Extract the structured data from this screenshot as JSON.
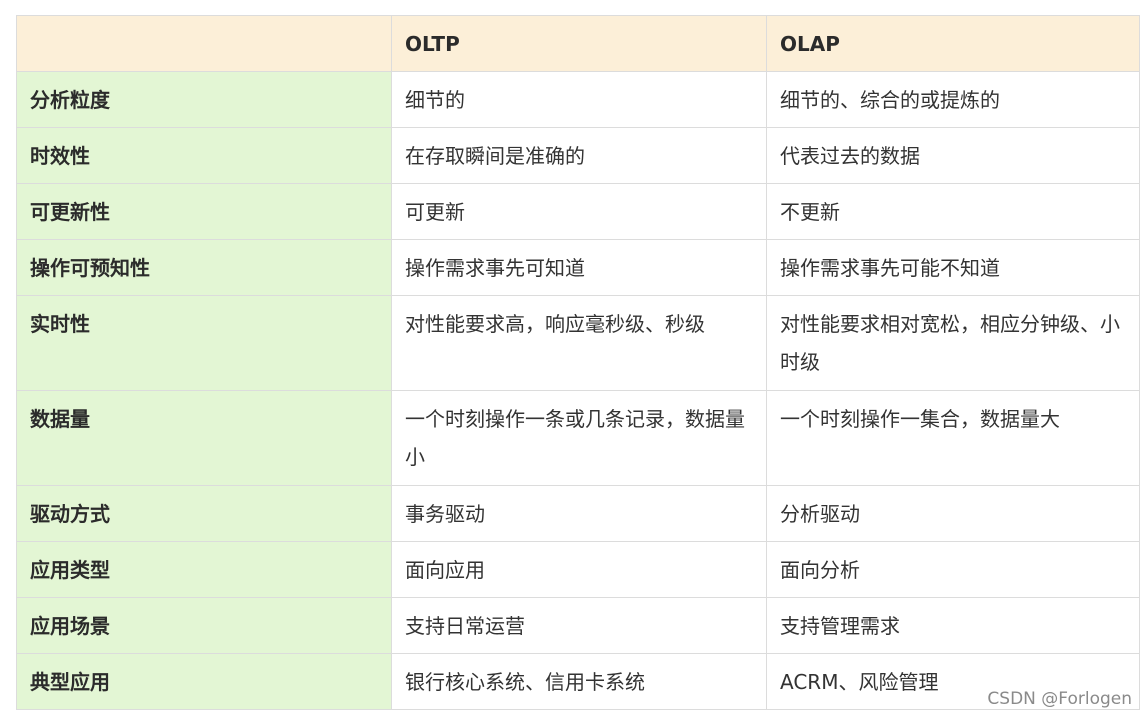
{
  "table": {
    "headers": [
      "",
      "OLTP",
      "OLAP"
    ],
    "rows": [
      {
        "key": "分析粒度",
        "oltp": "细节的",
        "olap": "细节的、综合的或提炼的"
      },
      {
        "key": "时效性",
        "oltp": "在存取瞬间是准确的",
        "olap": "代表过去的数据"
      },
      {
        "key": "可更新性",
        "oltp": "可更新",
        "olap": "不更新"
      },
      {
        "key": "操作可预知性",
        "oltp": "操作需求事先可知道",
        "olap": "操作需求事先可能不知道"
      },
      {
        "key": "实时性",
        "oltp": "对性能要求高，响应毫秒级、秒级",
        "olap": "对性能要求相对宽松，相应分钟级、小时级"
      },
      {
        "key": "数据量",
        "oltp": "一个时刻操作一条或几条记录，数据量小",
        "olap": "一个时刻操作一集合，数据量大"
      },
      {
        "key": "驱动方式",
        "oltp": "事务驱动",
        "olap": "分析驱动"
      },
      {
        "key": "应用类型",
        "oltp": "面向应用",
        "olap": "面向分析"
      },
      {
        "key": "应用场景",
        "oltp": "支持日常运营",
        "olap": "支持管理需求"
      },
      {
        "key": "典型应用",
        "oltp": "银行核心系统、信用卡系统",
        "olap": "ACRM、风险管理"
      }
    ]
  },
  "watermark": "CSDN @Forlogen"
}
